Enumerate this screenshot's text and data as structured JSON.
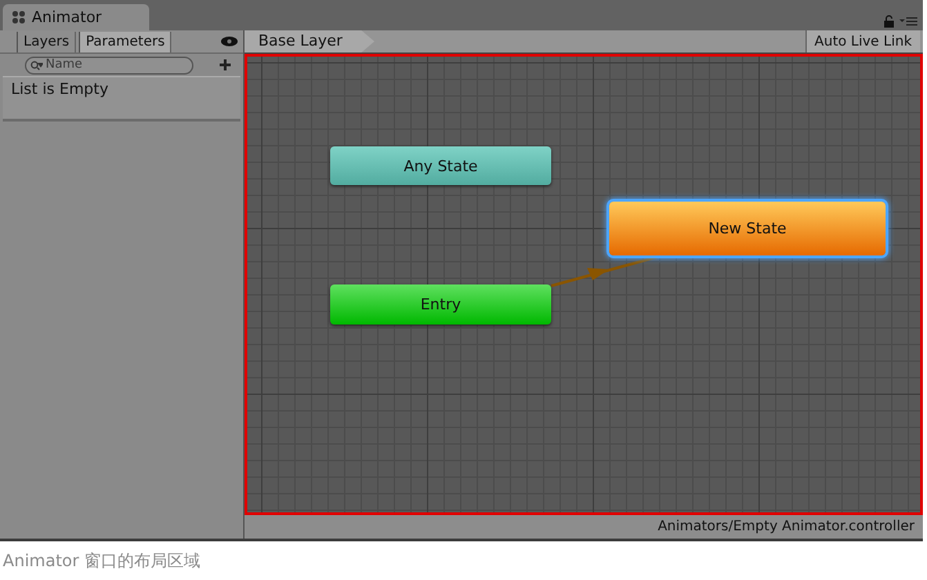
{
  "window": {
    "title": "Animator"
  },
  "tabs": [
    {
      "label": "Layers",
      "selected": false
    },
    {
      "label": "Parameters",
      "selected": true
    }
  ],
  "search": {
    "placeholder": "Name"
  },
  "parameters": {
    "empty_text": "List is Empty"
  },
  "breadcrumb": "Base Layer",
  "live_link_button": "Auto Live Link",
  "nodes": [
    {
      "kind": "any",
      "label": "Any State",
      "selected": false
    },
    {
      "kind": "state",
      "label": "New State",
      "selected": true
    },
    {
      "kind": "entry",
      "label": "Entry",
      "selected": false
    }
  ],
  "status_bar": "Animators/Empty Animator.controller",
  "caption": "Animator 窗口的布局区域"
}
